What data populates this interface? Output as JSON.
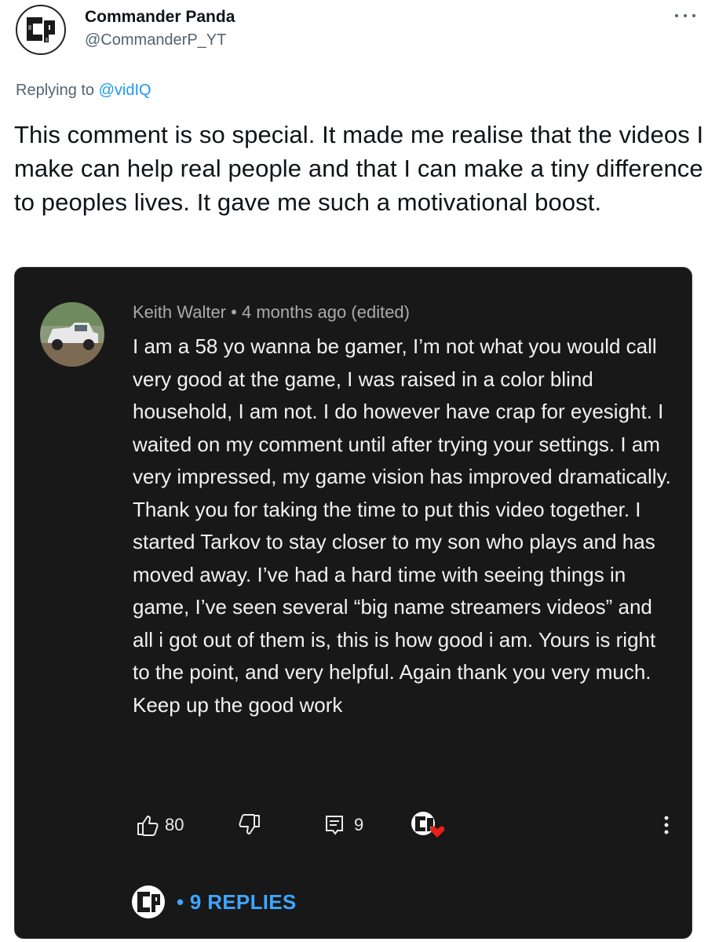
{
  "tweet": {
    "author_name": "Commander Panda",
    "author_handle": "@CommanderP_YT",
    "replying_prefix": "Replying to",
    "replying_to": "@vidIQ",
    "text": "This comment is so special. It made me realise that the videos I make can help real people and that I can make a tiny difference to peoples lives. It gave me such a motivational boost.",
    "avatar_monogram": "CP"
  },
  "comment": {
    "author": "Keith Walter",
    "separator": "•",
    "time": "4 months ago (edited)",
    "text": "I am a 58 yo wanna be gamer, I’m not what you would call very good at the game, I was raised in a color blind household, I am not. I do however have crap for eyesight. I waited on my comment until after trying your settings. I am very impressed, my game vision has improved dramatically. Thank you for taking the time to put this video together. I started Tarkov to stay closer to my son who plays and has moved away. I’ve had a hard time with seeing things in game, I’ve seen several “big name streamers videos” and all i got out of them is, this is how good i am. Yours is right to the point, and very helpful. Again thank you very much. Keep up the good work",
    "likes": "80",
    "reply_count": "9",
    "replies_label": "• 9 REPLIES"
  },
  "icons": {
    "more": "more-horizontal-icon",
    "like": "thumbs-up-icon",
    "dislike": "thumbs-down-icon",
    "reply": "comment-icon",
    "heart": "creator-heart-icon",
    "menu": "more-vertical-icon"
  },
  "colors": {
    "link": "#1d9bf0",
    "replies": "#3ea6ff",
    "card": "#181818",
    "heart": "#e62117"
  }
}
